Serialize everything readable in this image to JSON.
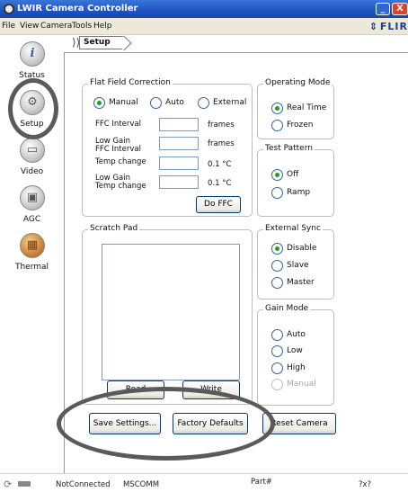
{
  "window": {
    "title": "LWIR Camera Controller",
    "minimize_glyph": "_",
    "close_glyph": "X"
  },
  "menu": {
    "items": [
      "File",
      "View",
      "Camera",
      "Tools",
      "Help"
    ],
    "brand": "FLIR",
    "brand_mark": "⇕"
  },
  "sidebar": {
    "items": [
      {
        "label": "Status",
        "icon": "info-icon",
        "glyph": "i"
      },
      {
        "label": "Setup",
        "icon": "gear-icon",
        "glyph": "⚙"
      },
      {
        "label": "Video",
        "icon": "monitor-icon",
        "glyph": "▭"
      },
      {
        "label": "AGC",
        "icon": "agc-icon",
        "glyph": "▣"
      },
      {
        "label": "Thermal",
        "icon": "thermal-image-icon",
        "glyph": "▦"
      }
    ]
  },
  "breadcrumb": {
    "chevron": "⟩⟩",
    "current": "Setup"
  },
  "ffc": {
    "title": "Flat Field Correction",
    "modes": [
      {
        "label": "Manual",
        "selected": true
      },
      {
        "label": "Auto",
        "selected": false
      },
      {
        "label": "External",
        "selected": false
      }
    ],
    "fields": [
      {
        "label": "FFC Interval",
        "value": "",
        "unit": "frames"
      },
      {
        "label": "Low Gain\nFFC Interval",
        "value": "",
        "unit": "frames"
      },
      {
        "label": "Temp change",
        "value": "",
        "unit": "0.1 °C"
      },
      {
        "label": "Low Gain\nTemp change",
        "value": "",
        "unit": "0.1 °C"
      }
    ],
    "do_ffc_label": "Do FFC"
  },
  "operating_mode": {
    "title": "Operating Mode",
    "options": [
      {
        "label": "Real Time",
        "selected": true
      },
      {
        "label": "Frozen",
        "selected": false
      }
    ]
  },
  "test_pattern": {
    "title": "Test Pattern",
    "options": [
      {
        "label": "Off",
        "selected": true
      },
      {
        "label": "Ramp",
        "selected": false
      }
    ]
  },
  "scratch_pad": {
    "title": "Scratch Pad",
    "read_label": "Read",
    "write_label": "Write"
  },
  "external_sync": {
    "title": "External Sync",
    "options": [
      {
        "label": "Disable",
        "selected": true
      },
      {
        "label": "Slave",
        "selected": false
      },
      {
        "label": "Master",
        "selected": false
      }
    ]
  },
  "gain_mode": {
    "title": "Gain Mode",
    "options": [
      {
        "label": "Auto",
        "selected": false,
        "disabled": false
      },
      {
        "label": "Low",
        "selected": false,
        "disabled": false
      },
      {
        "label": "High",
        "selected": false,
        "disabled": false
      },
      {
        "label": "Manual",
        "selected": false,
        "disabled": true
      }
    ]
  },
  "actions": {
    "save_label": "Save Settings...",
    "defaults_label": "Factory Defaults",
    "reset_label": "Reset Camera"
  },
  "status": {
    "connection": "NotConnected",
    "port": "MSCOMM",
    "part": "Part#",
    "rev": "?x?"
  }
}
